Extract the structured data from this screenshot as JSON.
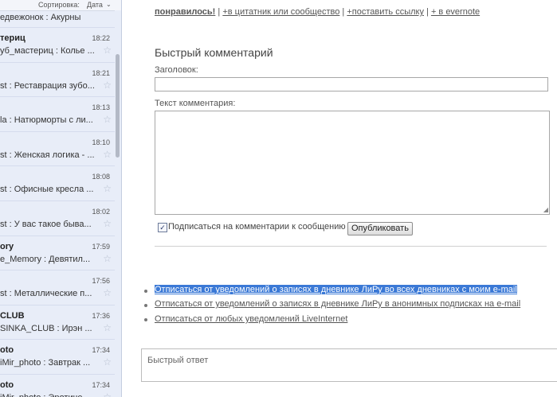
{
  "left_panel": {
    "sort_label": "Сортировка:",
    "sort_value": "Дата",
    "partial_top": "едвежонок : Акурны",
    "messages": [
      {
        "name": "териц",
        "time": "18:22",
        "snippet": "уб_мастериц : Колье ..."
      },
      {
        "name": "",
        "time": "18:21",
        "snippet": "st : Реставрация зубо..."
      },
      {
        "name": "",
        "time": "18:13",
        "snippet": "la : Натюрморты с ли..."
      },
      {
        "name": "",
        "time": "18:10",
        "snippet": "st : Женская логика - ..."
      },
      {
        "name": "",
        "time": "18:08",
        "snippet": "st : Офисные кресла ..."
      },
      {
        "name": "",
        "time": "18:02",
        "snippet": "st : У вас такое быва..."
      },
      {
        "name": "ory",
        "time": "17:59",
        "snippet": "e_Memory : Девятил..."
      },
      {
        "name": "",
        "time": "17:56",
        "snippet": "st : Металлические п..."
      },
      {
        "name": "CLUB",
        "time": "17:36",
        "snippet": "SINKA_CLUB : Ирэн ..."
      },
      {
        "name": "oto",
        "time": "17:34",
        "snippet": "iMir_photo : Завтрак ..."
      },
      {
        "name": "oto",
        "time": "17:34",
        "snippet": "iMir_photo : Эротиче..."
      }
    ]
  },
  "top_links": {
    "liked": "понравилось!",
    "quote": "+в цитатник или сообщество",
    "link": "+поставить ссылку",
    "evernote": "+ в evernote"
  },
  "form": {
    "title": "Быстрый комментарий",
    "subject_label": "Заголовок:",
    "subject_value": "",
    "text_label": "Текст комментария:",
    "text_value": "",
    "subscribe_label": "Подписаться на комментарии к сообщению",
    "subscribe_checked": true,
    "publish_button": "Опубликовать"
  },
  "unsubscribe_links": [
    "Отписаться от уведомлений о записях в дневнике ЛиРу во всех дневниках с моим e-mail",
    "Отписаться от уведомлений о записях в дневнике ЛиРу в анонимных подписках на e-mail",
    "Отписаться от любых уведомлений LiveInternet"
  ],
  "quick_reply_placeholder": "Быстрый ответ"
}
